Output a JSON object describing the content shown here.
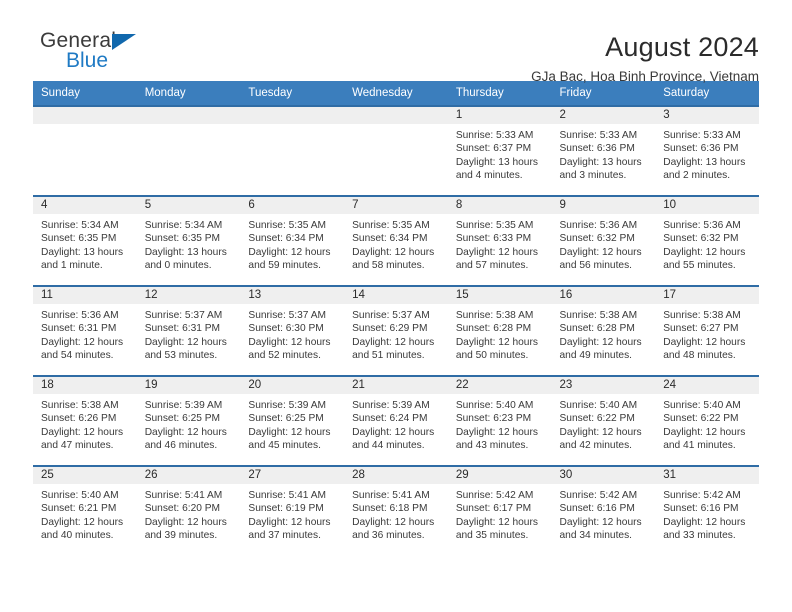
{
  "brand": {
    "name_part1": "General",
    "name_part2": "Blue",
    "triangle_color": "#1168ad",
    "blue_color": "#1f7ac4"
  },
  "header": {
    "title": "August 2024",
    "subtitle": "GJa Bac, Hoa Binh Province, Vietnam"
  },
  "theme": {
    "header_bg": "#3b7ebd",
    "row_border": "#2f6ca5",
    "daynum_bg": "#efefef"
  },
  "calendar": {
    "weekday_headers": [
      "Sunday",
      "Monday",
      "Tuesday",
      "Wednesday",
      "Thursday",
      "Friday",
      "Saturday"
    ],
    "weeks": [
      [
        {
          "day": "",
          "sunrise": "",
          "sunset": "",
          "daylight1": "",
          "daylight2": ""
        },
        {
          "day": "",
          "sunrise": "",
          "sunset": "",
          "daylight1": "",
          "daylight2": ""
        },
        {
          "day": "",
          "sunrise": "",
          "sunset": "",
          "daylight1": "",
          "daylight2": ""
        },
        {
          "day": "",
          "sunrise": "",
          "sunset": "",
          "daylight1": "",
          "daylight2": ""
        },
        {
          "day": "1",
          "sunrise": "Sunrise: 5:33 AM",
          "sunset": "Sunset: 6:37 PM",
          "daylight1": "Daylight: 13 hours",
          "daylight2": "and 4 minutes."
        },
        {
          "day": "2",
          "sunrise": "Sunrise: 5:33 AM",
          "sunset": "Sunset: 6:36 PM",
          "daylight1": "Daylight: 13 hours",
          "daylight2": "and 3 minutes."
        },
        {
          "day": "3",
          "sunrise": "Sunrise: 5:33 AM",
          "sunset": "Sunset: 6:36 PM",
          "daylight1": "Daylight: 13 hours",
          "daylight2": "and 2 minutes."
        }
      ],
      [
        {
          "day": "4",
          "sunrise": "Sunrise: 5:34 AM",
          "sunset": "Sunset: 6:35 PM",
          "daylight1": "Daylight: 13 hours",
          "daylight2": "and 1 minute."
        },
        {
          "day": "5",
          "sunrise": "Sunrise: 5:34 AM",
          "sunset": "Sunset: 6:35 PM",
          "daylight1": "Daylight: 13 hours",
          "daylight2": "and 0 minutes."
        },
        {
          "day": "6",
          "sunrise": "Sunrise: 5:35 AM",
          "sunset": "Sunset: 6:34 PM",
          "daylight1": "Daylight: 12 hours",
          "daylight2": "and 59 minutes."
        },
        {
          "day": "7",
          "sunrise": "Sunrise: 5:35 AM",
          "sunset": "Sunset: 6:34 PM",
          "daylight1": "Daylight: 12 hours",
          "daylight2": "and 58 minutes."
        },
        {
          "day": "8",
          "sunrise": "Sunrise: 5:35 AM",
          "sunset": "Sunset: 6:33 PM",
          "daylight1": "Daylight: 12 hours",
          "daylight2": "and 57 minutes."
        },
        {
          "day": "9",
          "sunrise": "Sunrise: 5:36 AM",
          "sunset": "Sunset: 6:32 PM",
          "daylight1": "Daylight: 12 hours",
          "daylight2": "and 56 minutes."
        },
        {
          "day": "10",
          "sunrise": "Sunrise: 5:36 AM",
          "sunset": "Sunset: 6:32 PM",
          "daylight1": "Daylight: 12 hours",
          "daylight2": "and 55 minutes."
        }
      ],
      [
        {
          "day": "11",
          "sunrise": "Sunrise: 5:36 AM",
          "sunset": "Sunset: 6:31 PM",
          "daylight1": "Daylight: 12 hours",
          "daylight2": "and 54 minutes."
        },
        {
          "day": "12",
          "sunrise": "Sunrise: 5:37 AM",
          "sunset": "Sunset: 6:31 PM",
          "daylight1": "Daylight: 12 hours",
          "daylight2": "and 53 minutes."
        },
        {
          "day": "13",
          "sunrise": "Sunrise: 5:37 AM",
          "sunset": "Sunset: 6:30 PM",
          "daylight1": "Daylight: 12 hours",
          "daylight2": "and 52 minutes."
        },
        {
          "day": "14",
          "sunrise": "Sunrise: 5:37 AM",
          "sunset": "Sunset: 6:29 PM",
          "daylight1": "Daylight: 12 hours",
          "daylight2": "and 51 minutes."
        },
        {
          "day": "15",
          "sunrise": "Sunrise: 5:38 AM",
          "sunset": "Sunset: 6:28 PM",
          "daylight1": "Daylight: 12 hours",
          "daylight2": "and 50 minutes."
        },
        {
          "day": "16",
          "sunrise": "Sunrise: 5:38 AM",
          "sunset": "Sunset: 6:28 PM",
          "daylight1": "Daylight: 12 hours",
          "daylight2": "and 49 minutes."
        },
        {
          "day": "17",
          "sunrise": "Sunrise: 5:38 AM",
          "sunset": "Sunset: 6:27 PM",
          "daylight1": "Daylight: 12 hours",
          "daylight2": "and 48 minutes."
        }
      ],
      [
        {
          "day": "18",
          "sunrise": "Sunrise: 5:38 AM",
          "sunset": "Sunset: 6:26 PM",
          "daylight1": "Daylight: 12 hours",
          "daylight2": "and 47 minutes."
        },
        {
          "day": "19",
          "sunrise": "Sunrise: 5:39 AM",
          "sunset": "Sunset: 6:25 PM",
          "daylight1": "Daylight: 12 hours",
          "daylight2": "and 46 minutes."
        },
        {
          "day": "20",
          "sunrise": "Sunrise: 5:39 AM",
          "sunset": "Sunset: 6:25 PM",
          "daylight1": "Daylight: 12 hours",
          "daylight2": "and 45 minutes."
        },
        {
          "day": "21",
          "sunrise": "Sunrise: 5:39 AM",
          "sunset": "Sunset: 6:24 PM",
          "daylight1": "Daylight: 12 hours",
          "daylight2": "and 44 minutes."
        },
        {
          "day": "22",
          "sunrise": "Sunrise: 5:40 AM",
          "sunset": "Sunset: 6:23 PM",
          "daylight1": "Daylight: 12 hours",
          "daylight2": "and 43 minutes."
        },
        {
          "day": "23",
          "sunrise": "Sunrise: 5:40 AM",
          "sunset": "Sunset: 6:22 PM",
          "daylight1": "Daylight: 12 hours",
          "daylight2": "and 42 minutes."
        },
        {
          "day": "24",
          "sunrise": "Sunrise: 5:40 AM",
          "sunset": "Sunset: 6:22 PM",
          "daylight1": "Daylight: 12 hours",
          "daylight2": "and 41 minutes."
        }
      ],
      [
        {
          "day": "25",
          "sunrise": "Sunrise: 5:40 AM",
          "sunset": "Sunset: 6:21 PM",
          "daylight1": "Daylight: 12 hours",
          "daylight2": "and 40 minutes."
        },
        {
          "day": "26",
          "sunrise": "Sunrise: 5:41 AM",
          "sunset": "Sunset: 6:20 PM",
          "daylight1": "Daylight: 12 hours",
          "daylight2": "and 39 minutes."
        },
        {
          "day": "27",
          "sunrise": "Sunrise: 5:41 AM",
          "sunset": "Sunset: 6:19 PM",
          "daylight1": "Daylight: 12 hours",
          "daylight2": "and 37 minutes."
        },
        {
          "day": "28",
          "sunrise": "Sunrise: 5:41 AM",
          "sunset": "Sunset: 6:18 PM",
          "daylight1": "Daylight: 12 hours",
          "daylight2": "and 36 minutes."
        },
        {
          "day": "29",
          "sunrise": "Sunrise: 5:42 AM",
          "sunset": "Sunset: 6:17 PM",
          "daylight1": "Daylight: 12 hours",
          "daylight2": "and 35 minutes."
        },
        {
          "day": "30",
          "sunrise": "Sunrise: 5:42 AM",
          "sunset": "Sunset: 6:16 PM",
          "daylight1": "Daylight: 12 hours",
          "daylight2": "and 34 minutes."
        },
        {
          "day": "31",
          "sunrise": "Sunrise: 5:42 AM",
          "sunset": "Sunset: 6:16 PM",
          "daylight1": "Daylight: 12 hours",
          "daylight2": "and 33 minutes."
        }
      ]
    ]
  }
}
